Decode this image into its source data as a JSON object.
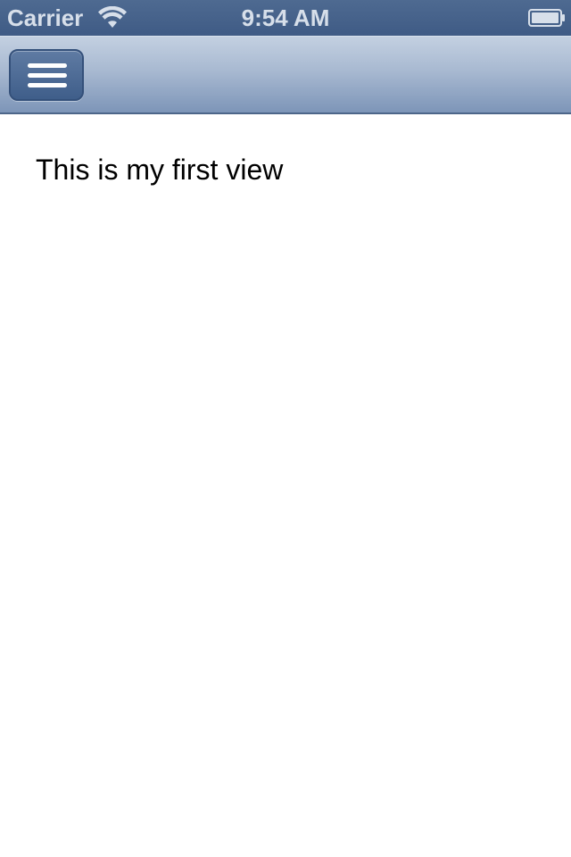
{
  "status_bar": {
    "carrier": "Carrier",
    "time": "9:54 AM",
    "wifi_icon": "wifi-icon",
    "battery_icon": "battery-icon"
  },
  "nav_bar": {
    "menu_icon": "hamburger-menu-icon"
  },
  "content": {
    "label": "This is my first view"
  },
  "colors": {
    "status_bar": "#4a6690",
    "nav_bar_top": "#c3d0e1",
    "nav_bar_bottom": "#7d95b8",
    "menu_button": "#4f6d97",
    "background": "#ffffff",
    "text": "#000000"
  }
}
